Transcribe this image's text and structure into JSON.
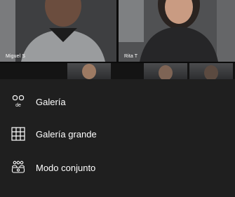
{
  "participants": [
    {
      "name": "Miguel S"
    },
    {
      "name": "Rita T"
    }
  ],
  "layout_menu": {
    "items": [
      {
        "label": "Galería",
        "icon": "gallery-icon",
        "icon_caption": "de"
      },
      {
        "label": "Galería grande",
        "icon": "large-gallery-icon"
      },
      {
        "label": "Modo conjunto",
        "icon": "together-mode-icon"
      }
    ]
  },
  "colors": {
    "sheet_background": "#1f1f1f",
    "text": "#ffffff"
  }
}
